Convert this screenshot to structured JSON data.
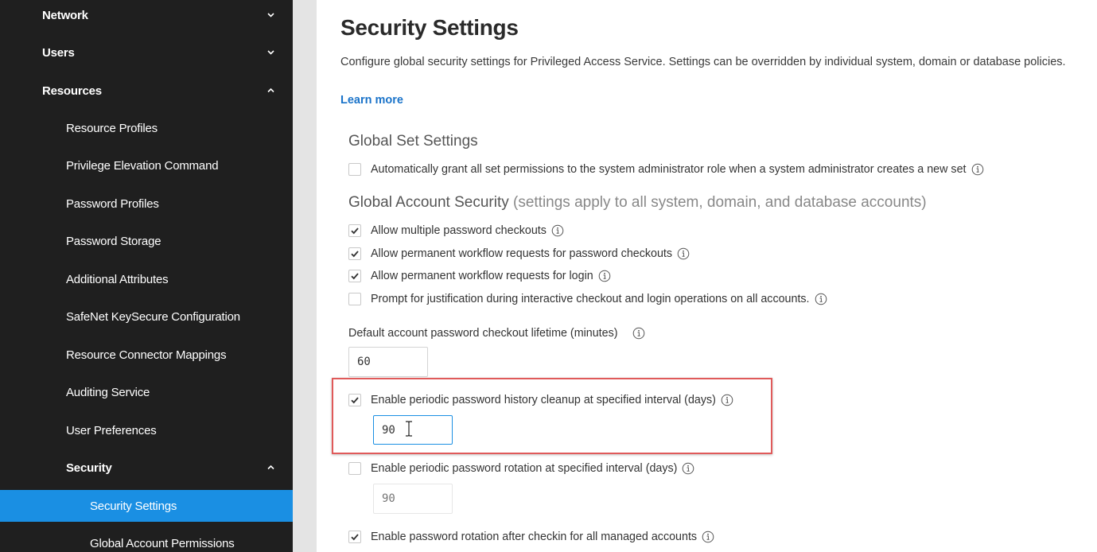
{
  "colors": {
    "sidebar_bg": "#1f1f1f",
    "sidebar_active": "#1a8fe3",
    "link": "#1a73c9",
    "highlight": "#e05a5a"
  },
  "sidebar": {
    "items": [
      {
        "label": "Network",
        "level": 1,
        "chevron": "chevron-down-icon"
      },
      {
        "label": "Users",
        "level": 1,
        "chevron": "chevron-down-icon"
      },
      {
        "label": "Resources",
        "level": 1,
        "chevron": "chevron-up-icon"
      },
      {
        "label": "Resource Profiles",
        "level": 2
      },
      {
        "label": "Privilege Elevation Command",
        "level": 2
      },
      {
        "label": "Password Profiles",
        "level": 2
      },
      {
        "label": "Password Storage",
        "level": 2
      },
      {
        "label": "Additional Attributes",
        "level": 2
      },
      {
        "label": "SafeNet KeySecure Configuration",
        "level": 2
      },
      {
        "label": "Resource Connector Mappings",
        "level": 2
      },
      {
        "label": "Auditing Service",
        "level": 2
      },
      {
        "label": "User Preferences",
        "level": 2
      },
      {
        "label": "Security",
        "level": 2,
        "chevron": "chevron-up-icon"
      },
      {
        "label": "Security Settings",
        "level": 3,
        "active": true
      },
      {
        "label": "Global Account Permissions",
        "level": 3
      }
    ]
  },
  "main": {
    "title": "Security Settings",
    "description": "Configure global security settings for Privileged Access Service. Settings can be overridden by individual system, domain or database policies.",
    "learn_more": "Learn more",
    "global_set": {
      "title": "Global Set Settings",
      "auto_grant": {
        "label": "Automatically grant all set permissions to the system administrator role when a system administrator creates a new set",
        "checked": false
      }
    },
    "global_account": {
      "title": "Global Account Security",
      "note": "(settings apply to all system, domain, and database accounts)",
      "multiple_checkouts": {
        "label": "Allow multiple password checkouts",
        "checked": true
      },
      "workflow_checkouts": {
        "label": "Allow permanent workflow requests for password checkouts",
        "checked": true
      },
      "workflow_login": {
        "label": "Allow permanent workflow requests for login",
        "checked": true
      },
      "justification": {
        "label": "Prompt for justification during interactive checkout and login operations on all accounts.",
        "checked": false
      },
      "checkout_lifetime": {
        "label": "Default account password checkout lifetime (minutes)",
        "value": "60"
      },
      "history_cleanup": {
        "label": "Enable periodic password history cleanup at specified interval (days)",
        "checked": true,
        "value": "90"
      },
      "periodic_rotation": {
        "label": "Enable periodic password rotation at specified interval (days)",
        "checked": false,
        "placeholder": "90"
      },
      "rotation_after_checkin": {
        "label": "Enable password rotation after checkin for all managed accounts",
        "checked": true
      }
    }
  }
}
